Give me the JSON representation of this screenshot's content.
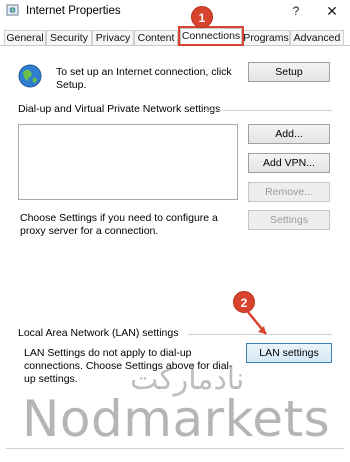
{
  "window": {
    "title": "Internet Properties",
    "help_glyph": "?",
    "close_glyph": "✕",
    "icon": "internet-options-icon"
  },
  "tabs": [
    {
      "label": "General",
      "active": false
    },
    {
      "label": "Security",
      "active": false
    },
    {
      "label": "Privacy",
      "active": false
    },
    {
      "label": "Content",
      "active": false
    },
    {
      "label": "Connections",
      "active": true
    },
    {
      "label": "Programs",
      "active": false
    },
    {
      "label": "Advanced",
      "active": false
    }
  ],
  "annotations": {
    "step1": "1",
    "step2": "2",
    "color": "#d8432e"
  },
  "setup": {
    "icon": "globe-icon",
    "text": "To set up an Internet connection, click Setup.",
    "button": "Setup"
  },
  "dialup": {
    "heading": "Dial-up and Virtual Private Network settings",
    "add_button": "Add...",
    "add_vpn_button": "Add VPN...",
    "remove_button": "Remove...",
    "settings_button": "Settings",
    "proxy_text": "Choose Settings if you need to configure a proxy server for a connection."
  },
  "lan": {
    "heading": "Local Area Network (LAN) settings",
    "text": "LAN Settings do not apply to dial-up connections. Choose Settings above for dial-up settings.",
    "button": "LAN settings"
  },
  "watermark": {
    "persian": "نادمارکت",
    "english": "Nodmarkets"
  }
}
